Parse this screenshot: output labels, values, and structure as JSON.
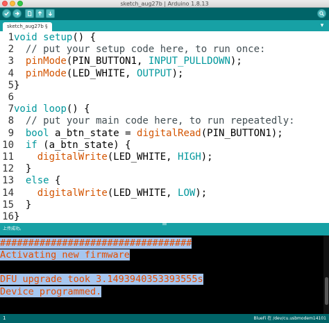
{
  "window": {
    "title": "sketch_aug27b | Arduino 1.8.13"
  },
  "toolbar": {
    "buttons": [
      {
        "icon": "verify-icon"
      },
      {
        "icon": "upload-icon"
      },
      {
        "icon": "new-icon"
      },
      {
        "icon": "open-icon"
      },
      {
        "icon": "save-icon"
      }
    ],
    "monitor_icon": "serial-monitor-icon"
  },
  "tabs": [
    {
      "label": "sketch_aug27b §"
    }
  ],
  "tab_menu": "▾",
  "editor": {
    "lines": [
      {
        "n": "1",
        "segments": [
          {
            "t": "void",
            "c": "kw"
          },
          {
            "t": " "
          },
          {
            "t": "setup",
            "c": "kw"
          },
          {
            "t": "() {"
          }
        ]
      },
      {
        "n": "2",
        "segments": [
          {
            "t": "  // put your setup code here, to run once:",
            "c": "cm"
          }
        ]
      },
      {
        "n": "3",
        "segments": [
          {
            "t": "  "
          },
          {
            "t": "pinMode",
            "c": "fn"
          },
          {
            "t": "(PIN_BUTTON1, "
          },
          {
            "t": "INPUT_PULLDOWN",
            "c": "cst"
          },
          {
            "t": ");"
          }
        ]
      },
      {
        "n": "4",
        "segments": [
          {
            "t": "  "
          },
          {
            "t": "pinMode",
            "c": "fn"
          },
          {
            "t": "(LED_WHITE, "
          },
          {
            "t": "OUTPUT",
            "c": "cst"
          },
          {
            "t": ");"
          }
        ]
      },
      {
        "n": "5",
        "segments": [
          {
            "t": "}"
          }
        ]
      },
      {
        "n": "6",
        "segments": [
          {
            "t": ""
          }
        ]
      },
      {
        "n": "7",
        "segments": [
          {
            "t": "void",
            "c": "kw"
          },
          {
            "t": " "
          },
          {
            "t": "loop",
            "c": "kw"
          },
          {
            "t": "() {"
          }
        ]
      },
      {
        "n": "8",
        "segments": [
          {
            "t": "  // put your main code here, to run repeatedly:",
            "c": "cm"
          }
        ]
      },
      {
        "n": "9",
        "segments": [
          {
            "t": "  "
          },
          {
            "t": "bool",
            "c": "kw"
          },
          {
            "t": " a_btn_state = "
          },
          {
            "t": "digitalRead",
            "c": "fn"
          },
          {
            "t": "(PIN_BUTTON1);"
          }
        ]
      },
      {
        "n": "10",
        "segments": [
          {
            "t": "  "
          },
          {
            "t": "if",
            "c": "kw"
          },
          {
            "t": " (a_btn_state) {"
          }
        ]
      },
      {
        "n": "11",
        "segments": [
          {
            "t": "    "
          },
          {
            "t": "digitalWrite",
            "c": "fn"
          },
          {
            "t": "(LED_WHITE, "
          },
          {
            "t": "HIGH",
            "c": "cst"
          },
          {
            "t": ");"
          }
        ]
      },
      {
        "n": "12",
        "segments": [
          {
            "t": "  }"
          }
        ]
      },
      {
        "n": "13",
        "segments": [
          {
            "t": "  "
          },
          {
            "t": "else",
            "c": "kw"
          },
          {
            "t": " {"
          }
        ]
      },
      {
        "n": "14",
        "segments": [
          {
            "t": "    "
          },
          {
            "t": "digitalWrite",
            "c": "fn"
          },
          {
            "t": "(LED_WHITE, "
          },
          {
            "t": "LOW",
            "c": "cst"
          },
          {
            "t": ");"
          }
        ]
      },
      {
        "n": "15",
        "segments": [
          {
            "t": "  }"
          }
        ]
      },
      {
        "n": "16",
        "segments": [
          {
            "t": "}"
          }
        ]
      }
    ]
  },
  "status": {
    "message": "上传成功。"
  },
  "console": {
    "lines": [
      {
        "text": "##################################",
        "highlight": true
      },
      {
        "text": "Activating new firmware",
        "highlight": true
      },
      {
        "text": "",
        "highlight": false
      },
      {
        "text": "DFU upgrade took 3.1493940353393555s",
        "highlight": true
      },
      {
        "text": "Device programmed.",
        "highlight": true
      }
    ]
  },
  "footer": {
    "line_number": "1",
    "board_port": "BlueFi 在 /dev/cu.usbmodem14101"
  }
}
